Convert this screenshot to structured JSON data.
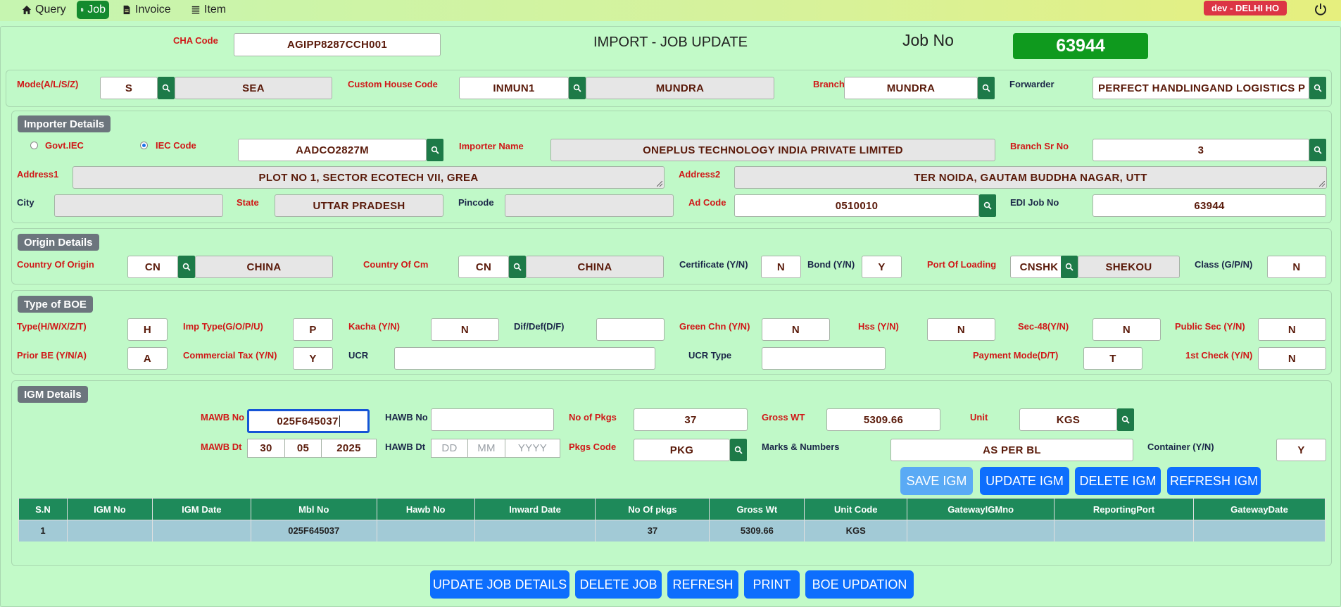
{
  "nav": {
    "items": [
      {
        "label": "Query",
        "icon": "home-icon"
      },
      {
        "label": "Job",
        "icon": "document-icon"
      },
      {
        "label": "Invoice",
        "icon": "file-icon"
      },
      {
        "label": "Item",
        "icon": "list-icon"
      }
    ],
    "branch_badge": "dev - DELHI HO"
  },
  "header": {
    "cha_code_label": "CHA Code",
    "cha_code_value": "AGIPP8287CCH001",
    "title": "IMPORT - JOB UPDATE",
    "job_no_label": "Job No",
    "job_no_value": "63944"
  },
  "mode_row": {
    "mode_label": "Mode(A/L/S/Z)",
    "mode_code": "S",
    "mode_name": "SEA",
    "custom_house_label": "Custom House Code",
    "custom_house_code": "INMUN1",
    "custom_house_name": "MUNDRA",
    "branch_label": "Branch",
    "branch_value": "MUNDRA",
    "forwarder_label": "Forwarder",
    "forwarder_value": "PERFECT HANDLINGAND LOGISTICS P"
  },
  "importer": {
    "title": "Importer Details",
    "govt_iec_label": "Govt.IEC",
    "iec_code_label": "IEC Code",
    "iec_code_value": "AADCO2827M",
    "importer_name_label": "Importer Name",
    "importer_name_value": "ONEPLUS TECHNOLOGY INDIA PRIVATE LIMITED",
    "branch_sr_label": "Branch Sr No",
    "branch_sr_value": "3",
    "address1_label": "Address1",
    "address1_value": "PLOT NO 1, SECTOR ECOTECH VII, GREA",
    "address2_label": "Address2",
    "address2_value": "TER NOIDA, GAUTAM BUDDHA NAGAR, UTT",
    "city_label": "City",
    "city_value": "",
    "state_label": "State",
    "state_value": "UTTAR PRADESH",
    "pincode_label": "Pincode",
    "pincode_value": "",
    "ad_code_label": "Ad Code",
    "ad_code_value": "0510010",
    "edi_job_label": "EDI Job No",
    "edi_job_value": "63944"
  },
  "origin": {
    "title": "Origin Details",
    "country_origin_label": "Country Of Origin",
    "country_origin_code": "CN",
    "country_origin_name": "CHINA",
    "country_cm_label": "Country Of Cm",
    "country_cm_code": "CN",
    "country_cm_name": "CHINA",
    "certificate_label": "Certificate (Y/N)",
    "certificate_value": "N",
    "bond_label": "Bond (Y/N)",
    "bond_value": "Y",
    "port_loading_label": "Port Of Loading",
    "port_loading_code": "CNSHK",
    "port_loading_name": "SHEKOU",
    "class_label": "Class (G/P/N)",
    "class_value": "N"
  },
  "boe": {
    "title": "Type of BOE",
    "type_label": "Type(H/W/X/Z/T)",
    "type_value": "H",
    "imp_type_label": "Imp Type(G/O/P/U)",
    "imp_type_value": "P",
    "kacha_label": "Kacha (Y/N)",
    "kacha_value": "N",
    "difdef_label": "Dif/Def(D/F)",
    "difdef_value": "",
    "green_chn_label": "Green Chn (Y/N)",
    "green_chn_value": "N",
    "hss_label": "Hss (Y/N)",
    "hss_value": "N",
    "sec48_label": "Sec-48(Y/N)",
    "sec48_value": "N",
    "public_sec_label": "Public Sec (Y/N)",
    "public_sec_value": "N",
    "prior_be_label": "Prior BE (Y/N/A)",
    "prior_be_value": "A",
    "commercial_tax_label": "Commercial Tax (Y/N)",
    "commercial_tax_value": "Y",
    "ucr_label": "UCR",
    "ucr_value": "",
    "ucr_type_label": "UCR Type",
    "ucr_type_value": "",
    "payment_mode_label": "Payment Mode(D/T)",
    "payment_mode_value": "T",
    "first_check_label": "1st Check (Y/N)",
    "first_check_value": "N"
  },
  "igm": {
    "title": "IGM Details",
    "mawb_no_label": "MAWB No",
    "mawb_no_value": "025F645037",
    "hawb_no_label": "HAWB No",
    "hawb_no_value": "",
    "no_pkgs_label": "No of Pkgs",
    "no_pkgs_value": "37",
    "gross_wt_label": "Gross WT",
    "gross_wt_value": "5309.66",
    "unit_label": "Unit",
    "unit_value": "KGS",
    "mawb_dt_label": "MAWB Dt",
    "mawb_dd": "30",
    "mawb_mm": "05",
    "mawb_yyyy": "2025",
    "hawb_dt_label": "HAWB Dt",
    "hawb_dd_ph": "DD",
    "hawb_mm_ph": "MM",
    "hawb_yyyy_ph": "YYYY",
    "pkgs_code_label": "Pkgs Code",
    "pkgs_code_value": "PKG",
    "marks_label": "Marks & Numbers",
    "marks_value": "AS PER BL",
    "container_label": "Container (Y/N)",
    "container_value": "Y",
    "buttons": {
      "save": "SAVE IGM",
      "update": "UPDATE IGM",
      "delete": "DELETE IGM",
      "refresh": "REFRESH IGM"
    },
    "table": {
      "headers": [
        "S.N",
        "IGM No",
        "IGM Date",
        "Mbl No",
        "Hawb No",
        "Inward Date",
        "No Of pkgs",
        "Gross Wt",
        "Unit Code",
        "GatewayIGMno",
        "ReportingPort",
        "GatewayDate"
      ],
      "rows": [
        [
          "1",
          "",
          "",
          "025F645037",
          "",
          "",
          "37",
          "5309.66",
          "KGS",
          "",
          "",
          ""
        ]
      ]
    }
  },
  "footer_buttons": {
    "update_job": "UPDATE JOB DETAILS",
    "delete_job": "DELETE JOB",
    "refresh": "REFRESH",
    "print": "PRINT",
    "boe_updation": "BOE UPDATION"
  },
  "colors": {
    "page_bg": "#c2fac8",
    "accent_green": "#138a2e",
    "search_button": "#1d7a48",
    "primary_blue": "#0d6efd",
    "label_red": "#d01818",
    "badge_red": "#dc3545"
  }
}
